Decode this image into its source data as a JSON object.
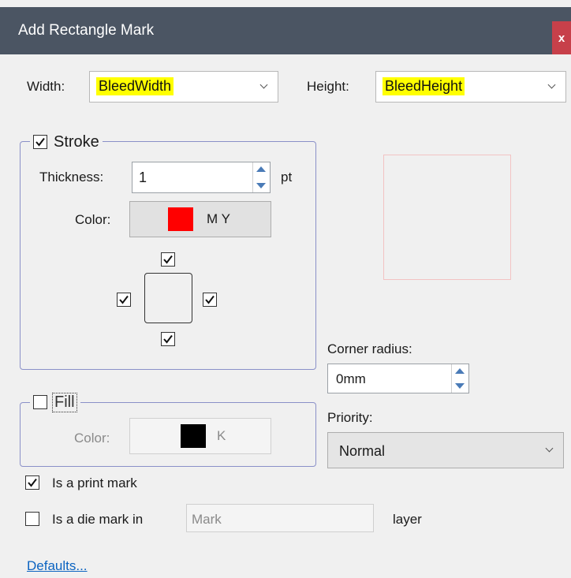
{
  "window": {
    "title": "Add Rectangle Mark",
    "close_label": "x"
  },
  "width": {
    "label": "Width:",
    "value": "BleedWidth"
  },
  "height": {
    "label": "Height:",
    "value": "BleedHeight"
  },
  "stroke": {
    "label": "Stroke",
    "checked": true,
    "thickness_label": "Thickness:",
    "thickness_value": "1",
    "thickness_unit": "pt",
    "color_label": "Color:",
    "color_name": "M Y",
    "swatch_color": "#ff0000",
    "sides": {
      "top": true,
      "left": true,
      "right": true,
      "bottom": true
    }
  },
  "fill": {
    "label": "Fill",
    "checked": false,
    "color_label": "Color:",
    "color_name": "K",
    "swatch_color": "#000000"
  },
  "corner_radius": {
    "label": "Corner radius:",
    "value": "0mm"
  },
  "priority": {
    "label": "Priority:",
    "value": "Normal"
  },
  "print_mark": {
    "label": "Is a print mark",
    "checked": true
  },
  "die_mark": {
    "label": "Is a die mark in",
    "placeholder": "Mark",
    "suffix": "layer",
    "checked": false
  },
  "defaults_link": "Defaults...",
  "colors": {
    "title_bar": "#4b5563",
    "close": "#c7404a",
    "highlight": "#ffff00",
    "link": "#0b63c1",
    "group_border": "#8a90c8"
  }
}
